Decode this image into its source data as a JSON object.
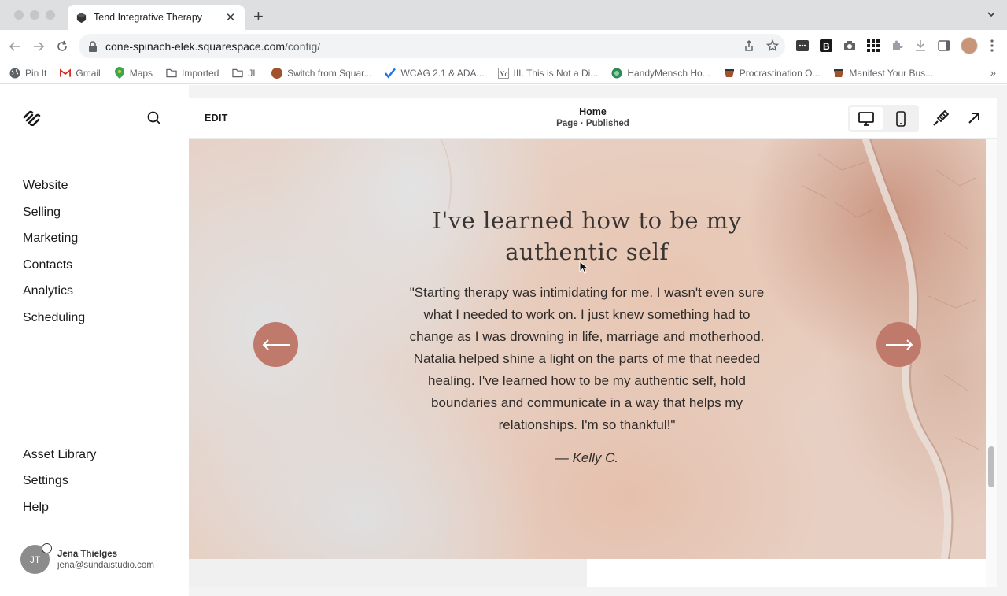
{
  "browser": {
    "tab": {
      "title": "Tend Integrative Therapy"
    },
    "url": {
      "host": "cone-spinach-elek.squarespace.com",
      "path": "/config/"
    },
    "bookmarks": [
      {
        "label": "Pin It",
        "icon": "globe-icon"
      },
      {
        "label": "Gmail",
        "icon": "gmail-icon"
      },
      {
        "label": "Maps",
        "icon": "maps-pin-icon"
      },
      {
        "label": "Imported",
        "icon": "folder-icon"
      },
      {
        "label": "JL",
        "icon": "folder-icon"
      },
      {
        "label": "Switch from Squar...",
        "icon": "site-favicon"
      },
      {
        "label": "WCAG 2.1 & ADA...",
        "icon": "check-favicon"
      },
      {
        "label": "III. This is Not a Di...",
        "icon": "yc-favicon"
      },
      {
        "label": "HandyMensch Ho...",
        "icon": "globe-favicon"
      },
      {
        "label": "Procrastination O...",
        "icon": "cup-favicon"
      },
      {
        "label": "Manifest Your Bus...",
        "icon": "cup-favicon"
      }
    ]
  },
  "sidebar": {
    "nav_top": [
      "Website",
      "Selling",
      "Marketing",
      "Contacts",
      "Analytics",
      "Scheduling"
    ],
    "nav_bottom": [
      "Asset Library",
      "Settings",
      "Help"
    ],
    "user": {
      "initials": "JT",
      "name": "Jena Thielges",
      "email": "jena@sundaistudio.com"
    }
  },
  "editor": {
    "edit_label": "EDIT",
    "page_title": "Home",
    "page_status": "Page · Published",
    "view_mode": "desktop"
  },
  "testimonial": {
    "heading_line1": "I've learned how to be my",
    "heading_line2": "authentic self",
    "quote_lines": [
      "\"Starting therapy was intimidating for me. I wasn't even sure",
      "what I needed to work on. I just knew something had to",
      "change as I was drowning in life, marriage and motherhood.",
      "Natalia helped shine a light on the parts of me that needed",
      "healing. I've learned how to be my authentic self, hold",
      "boundaries and communicate in a way that helps my",
      "relationships. I'm so thankful!\""
    ],
    "author": "— Kelly C.",
    "accent_color": "#c07a6c"
  }
}
